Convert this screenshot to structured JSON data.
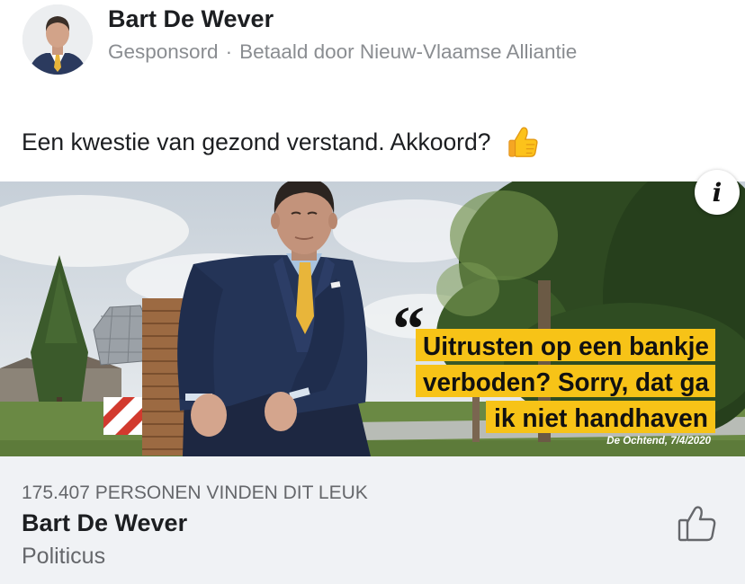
{
  "post": {
    "avatar_icon": "avatar-photo",
    "author_name": "Bart De Wever",
    "sponsored_label": "Gesponsord",
    "separator": "·",
    "paid_by": "Betaald door Nieuw-Vlaamse Alliantie",
    "message": "Een kwestie van gezond verstand. Akkoord?",
    "message_emoji": "thumbs-up-emoji"
  },
  "ad_image": {
    "info_label": "i",
    "quote_mark": "“",
    "quote_lines": [
      "Uitrusten op een bankje",
      "verboden? Sorry, dat ga",
      "ik niet handhaven"
    ],
    "source": "De Ochtend, 7/4/2020"
  },
  "page_card": {
    "likes_text": "175.407 PERSONEN VINDEN DIT LEUK",
    "page_name": "Bart De Wever",
    "category": "Politicus",
    "like_icon": "thumbs-up-outline-icon"
  },
  "colors": {
    "text_primary": "#1c1e21",
    "text_secondary": "#65676b",
    "card_background": "#f0f2f5",
    "quote_highlight": "#f7c317",
    "tie_yellow": "#e8b53a",
    "suit_navy": "#243457"
  }
}
